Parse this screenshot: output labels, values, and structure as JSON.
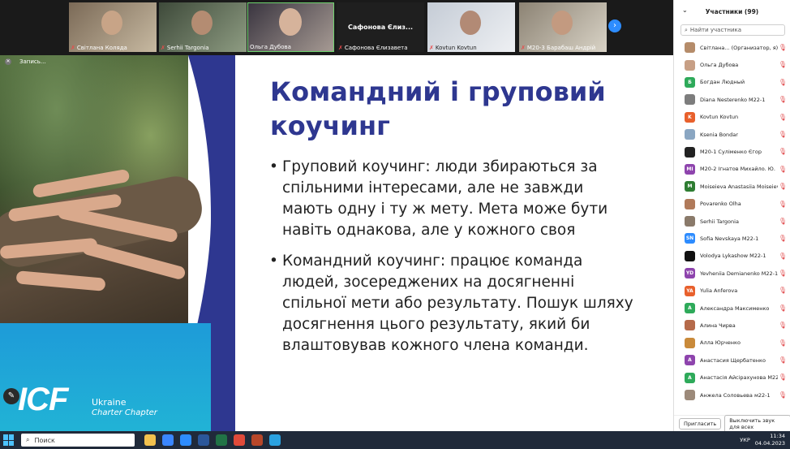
{
  "strip": {
    "tiles": [
      {
        "name": "Світлана Коляда"
      },
      {
        "name": "Serhii Targonia"
      },
      {
        "name": "Ольга Дубова"
      },
      {
        "name": "Сафонова Єлизавета",
        "center": "Сафонова Єлиз..."
      },
      {
        "name": "Kovtun Kovtun"
      },
      {
        "name": "M20-3 Барабаш Андрій"
      }
    ],
    "next_icon": "›"
  },
  "slide": {
    "recording_label": "Запись...",
    "title": "Командний і груповий коучинг",
    "bullets": [
      "Груповий коучинг: люди збираються за спільними інтересами, але не завжди мають одну і ту ж мету. Мета може бути навіть однакова, але у кожного своя",
      "Командний коучинг: працює команда людей, зосереджених на досягненні спільної мети або результату. Пошук шляху досягнення цього результату, який би влаштовував кожного члена команди."
    ],
    "logo_text": "ICF",
    "logo_ukraine": "Ukraine",
    "logo_chapter": "Charter Chapter"
  },
  "panel": {
    "title": "Участники (99)",
    "search_placeholder": "Найти участника",
    "participants": [
      {
        "name": "Світлана... (Организатор, я)",
        "initials": "",
        "color": "#b58c6a"
      },
      {
        "name": "Ольга Дубова",
        "initials": "",
        "color": "#c79f85"
      },
      {
        "name": "Богдан Людный",
        "initials": "Б",
        "color": "#2eaa5a"
      },
      {
        "name": "Diana Nesterenko M22-1",
        "initials": "",
        "color": "#7d7d7d"
      },
      {
        "name": "Kovtun Kovtun",
        "initials": "K",
        "color": "#e8602c"
      },
      {
        "name": "Ksenia Bondar",
        "initials": "",
        "color": "#8aa6c2"
      },
      {
        "name": "M20-1 Суліменко Єгор",
        "initials": "",
        "color": "#222222"
      },
      {
        "name": "M20-2 Ігнатов Михайло. Ю.",
        "initials": "MI",
        "color": "#8e44ad"
      },
      {
        "name": "Moiseieva Anastasiia Moiseieva",
        "initials": "M",
        "color": "#2e7d32"
      },
      {
        "name": "Povarenko Olha",
        "initials": "",
        "color": "#b07a5a"
      },
      {
        "name": "Serhii Targonia",
        "initials": "",
        "color": "#8a7a6a"
      },
      {
        "name": "Sofia Nevskaya M22-1",
        "initials": "SN",
        "color": "#2d8cff"
      },
      {
        "name": "Volodya Lykashow M22-1",
        "initials": "",
        "color": "#111111"
      },
      {
        "name": "Yevheniia Demianenko M22-1",
        "initials": "YD",
        "color": "#8e44ad"
      },
      {
        "name": "Yulia Anferova",
        "initials": "YA",
        "color": "#e8602c"
      },
      {
        "name": "Александра Максименко",
        "initials": "A",
        "color": "#2eaa5a"
      },
      {
        "name": "Алина Чирва",
        "initials": "",
        "color": "#b56a4a"
      },
      {
        "name": "Алла Юрченко",
        "initials": "",
        "color": "#c98a3a"
      },
      {
        "name": "Анастасия Щербатенко",
        "initials": "A",
        "color": "#8e44ad"
      },
      {
        "name": "Анастасія Айсірахунова M22-1",
        "initials": "A",
        "color": "#2eaa5a"
      },
      {
        "name": "Анжела Соловьева м22-1",
        "initials": "",
        "color": "#9c8a7a"
      }
    ],
    "invite_label": "Пригласить",
    "mute_all_label": "Выключить звук для всех"
  },
  "taskbar": {
    "search_label": "Поиск",
    "lang": "УКР",
    "time": "11:34",
    "date": "04.04.2023"
  }
}
